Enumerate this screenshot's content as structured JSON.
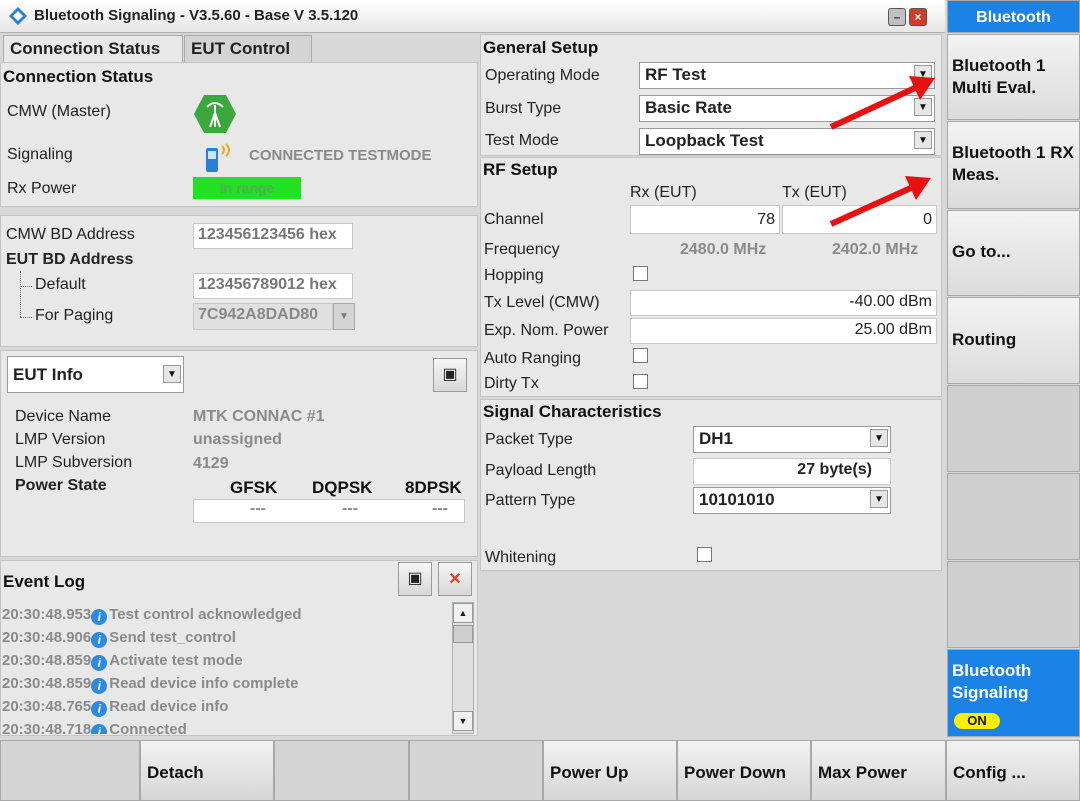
{
  "window": {
    "title": "Bluetooth Signaling  - V3.5.60 - Base V 3.5.120"
  },
  "tabs": [
    "Connection Status",
    "EUT Control"
  ],
  "connection_status": {
    "header": "Connection Status",
    "cmw_label": "CMW (Master)",
    "signaling_label": "Signaling",
    "signaling_state": "CONNECTED TESTMODE",
    "rx_power_label": "Rx Power",
    "rx_power_value": "In range",
    "cmw_bd_label": "CMW BD Address",
    "cmw_bd_value": "123456123456  hex",
    "eut_bd_label": "EUT BD Address",
    "default_label": "Default",
    "default_value": "123456789012  hex",
    "paging_label": "For Paging",
    "paging_value": "7C942A8DAD80"
  },
  "eut_info": {
    "select": "EUT Info",
    "device_name_label": "Device Name",
    "device_name": "MTK CONNAC #1",
    "lmp_version_label": "LMP Version",
    "lmp_version": "unassigned",
    "lmp_subversion_label": "LMP Subversion",
    "lmp_subversion": "4129",
    "power_state_label": "Power State",
    "cols": [
      "GFSK",
      "DQPSK",
      "8DPSK"
    ],
    "vals": [
      "---",
      "---",
      "---"
    ]
  },
  "event_log": {
    "header": "Event Log",
    "entries": [
      {
        "time": "20:30:48.953",
        "text": "Test control acknowledged"
      },
      {
        "time": "20:30:48.906",
        "text": "Send test_control"
      },
      {
        "time": "20:30:48.859",
        "text": "Activate test mode"
      },
      {
        "time": "20:30:48.859",
        "text": "Read device info complete"
      },
      {
        "time": "20:30:48.765",
        "text": "Read device info"
      },
      {
        "time": "20:30:48.718",
        "text": "Connected"
      }
    ]
  },
  "general_setup": {
    "header": "General Setup",
    "operating_mode_label": "Operating Mode",
    "operating_mode": "RF Test",
    "burst_type_label": "Burst Type",
    "burst_type": "Basic Rate",
    "test_mode_label": "Test Mode",
    "test_mode": "Loopback Test"
  },
  "rf_setup": {
    "header": "RF Setup",
    "rx_col": "Rx (EUT)",
    "tx_col": "Tx (EUT)",
    "channel_label": "Channel",
    "channel_rx": "78",
    "channel_tx": "0",
    "frequency_label": "Frequency",
    "freq_rx": "2480.0 MHz",
    "freq_tx": "2402.0 MHz",
    "hopping_label": "Hopping",
    "tx_level_label": "Tx Level (CMW)",
    "tx_level": "-40.00  dBm",
    "exp_power_label": "Exp. Nom. Power",
    "exp_power": "25.00  dBm",
    "auto_ranging_label": "Auto Ranging",
    "dirty_tx_label": "Dirty Tx"
  },
  "signal": {
    "header": "Signal Characteristics",
    "packet_type_label": "Packet Type",
    "packet_type": "DH1",
    "payload_label": "Payload Length",
    "payload": "27  byte(s)",
    "pattern_label": "Pattern Type",
    "pattern": "10101010",
    "whitening_label": "Whitening"
  },
  "softkeys": {
    "bluetooth": "Bluetooth",
    "multi_eval": "Bluetooth 1 Multi Eval.",
    "rx_meas": "Bluetooth 1 RX Meas.",
    "goto": "Go to...",
    "routing": "Routing",
    "signaling": "Bluetooth Signaling",
    "on_badge": "ON"
  },
  "bottom_keys": {
    "detach": "Detach",
    "power_up": "Power Up",
    "power_down": "Power Down",
    "max_power": "Max Power",
    "config": "Config ..."
  },
  "colors": {
    "accent_blue": "#1b82e6",
    "in_range_green": "#22e022",
    "on_yellow": "#ffee00",
    "arrow_red": "#e81010"
  }
}
